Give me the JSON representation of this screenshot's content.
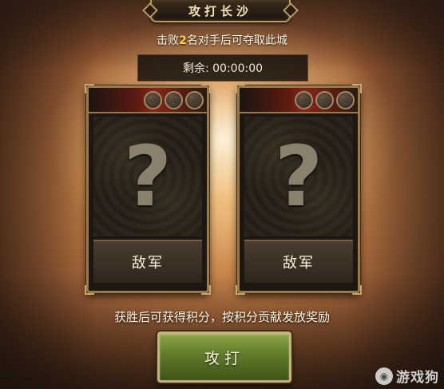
{
  "title": "攻打长沙",
  "objective": {
    "prefix": "击败",
    "count": "2",
    "suffix": "名对手后可夺取此城"
  },
  "timer": "剩余: 00:00:00",
  "cards": [
    {
      "stars": [
        "☆",
        "☆",
        "☆"
      ],
      "mystery": "?",
      "label": "敌军"
    },
    {
      "stars": [
        "☆",
        "☆",
        "☆"
      ],
      "mystery": "?",
      "label": "敌军"
    }
  ],
  "reward_note": "获胜后可获得积分，按积分贡献发放奖励",
  "attack_button": "攻打",
  "watermark": {
    "text": "游戏狗"
  },
  "colors": {
    "accent_gold": "#ffd04a",
    "button_green": "#5f7a2a",
    "frame_gold": "#9a7a4a"
  }
}
